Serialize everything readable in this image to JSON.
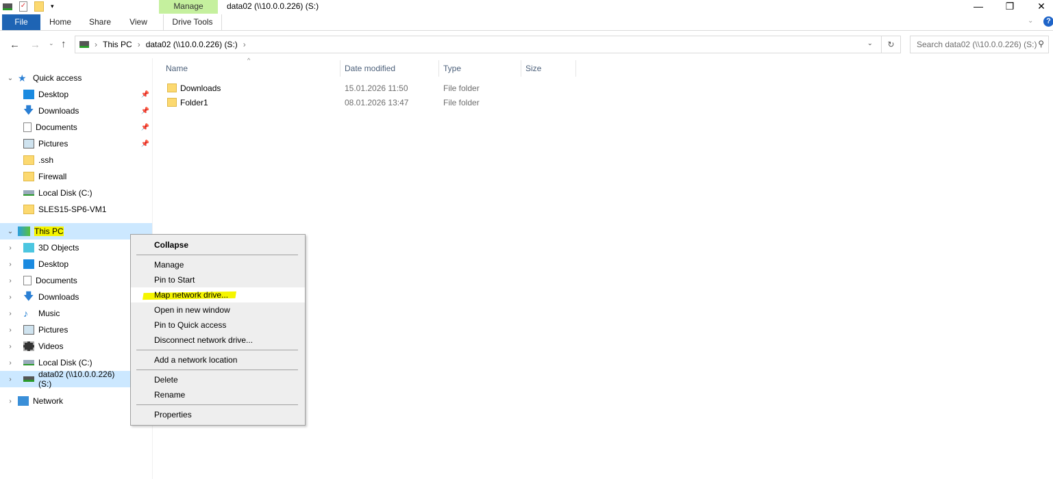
{
  "window": {
    "title": "data02 (\\\\10.0.0.226) (S:)",
    "context_tab": "Manage"
  },
  "ribbon": {
    "tabs": [
      "File",
      "Home",
      "Share",
      "View",
      "Drive Tools"
    ]
  },
  "address": {
    "crumbs": [
      "This PC",
      "data02 (\\\\10.0.0.226) (S:)"
    ]
  },
  "search": {
    "placeholder": "Search data02 (\\\\10.0.0.226) (S:)"
  },
  "nav": {
    "quick_access": "Quick access",
    "quick_items": [
      "Desktop",
      "Downloads",
      "Documents",
      "Pictures",
      ".ssh",
      "Firewall",
      "Local Disk (C:)",
      "SLES15-SP6-VM1"
    ],
    "this_pc": "This PC",
    "pc_items": [
      "3D Objects",
      "Desktop",
      "Documents",
      "Downloads",
      "Music",
      "Pictures",
      "Videos",
      "Local Disk (C:)",
      "data02 (\\\\10.0.0.226) (S:)"
    ],
    "network": "Network"
  },
  "columns": [
    "Name",
    "Date modified",
    "Type",
    "Size"
  ],
  "files": [
    {
      "name": "Downloads",
      "date": "15.01.2026 11:50",
      "type": "File folder"
    },
    {
      "name": "Folder1",
      "date": "08.01.2026 13:47",
      "type": "File folder"
    }
  ],
  "context_menu": [
    "Collapse",
    "Manage",
    "Pin to Start",
    "Map network drive...",
    "Open in new window",
    "Pin to Quick access",
    "Disconnect network drive...",
    "Add a network location",
    "Delete",
    "Rename",
    "Properties"
  ]
}
